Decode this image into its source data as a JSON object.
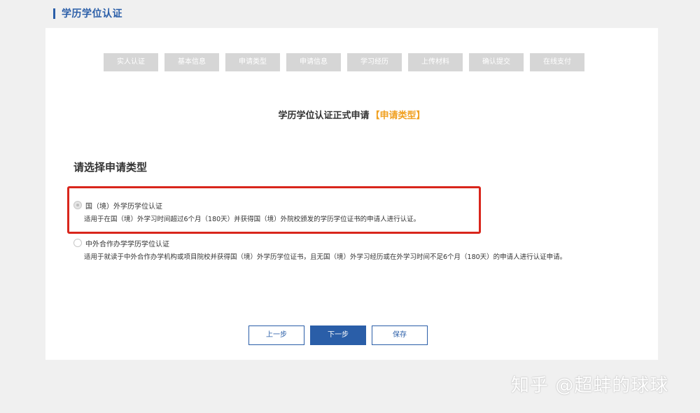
{
  "header": {
    "title": "学历学位认证"
  },
  "steps": [
    "实人认证",
    "基本信息",
    "申请类型",
    "申请信息",
    "学习经历",
    "上传材料",
    "确认提交",
    "在线支付"
  ],
  "headline": {
    "text": "学历学位认证正式申请",
    "highlight": "【申请类型】"
  },
  "section_title": "请选择申请类型",
  "options": [
    {
      "label": "国（境）外学历学位认证",
      "desc": "适用于在国（境）外学习时间超过6个月（180天）并获得国（境）外院校颁发的学历学位证书的申请人进行认证。",
      "checked": true
    },
    {
      "label": "中外合作办学学历学位认证",
      "desc": "适用于就读于中外合作办学机构或项目院校并获得国（境）外学历学位证书，且无国（境）外学习经历或在外学习时间不足6个月（180天）的申请人进行认证申请。",
      "checked": false
    }
  ],
  "buttons": {
    "prev": "上一步",
    "next": "下一步",
    "save": "保存"
  },
  "watermark": "知乎 @超蚌的球球",
  "colors": {
    "accent": "#2a5ea8",
    "highlight": "#f0a020",
    "annotation": "#d9261c"
  }
}
